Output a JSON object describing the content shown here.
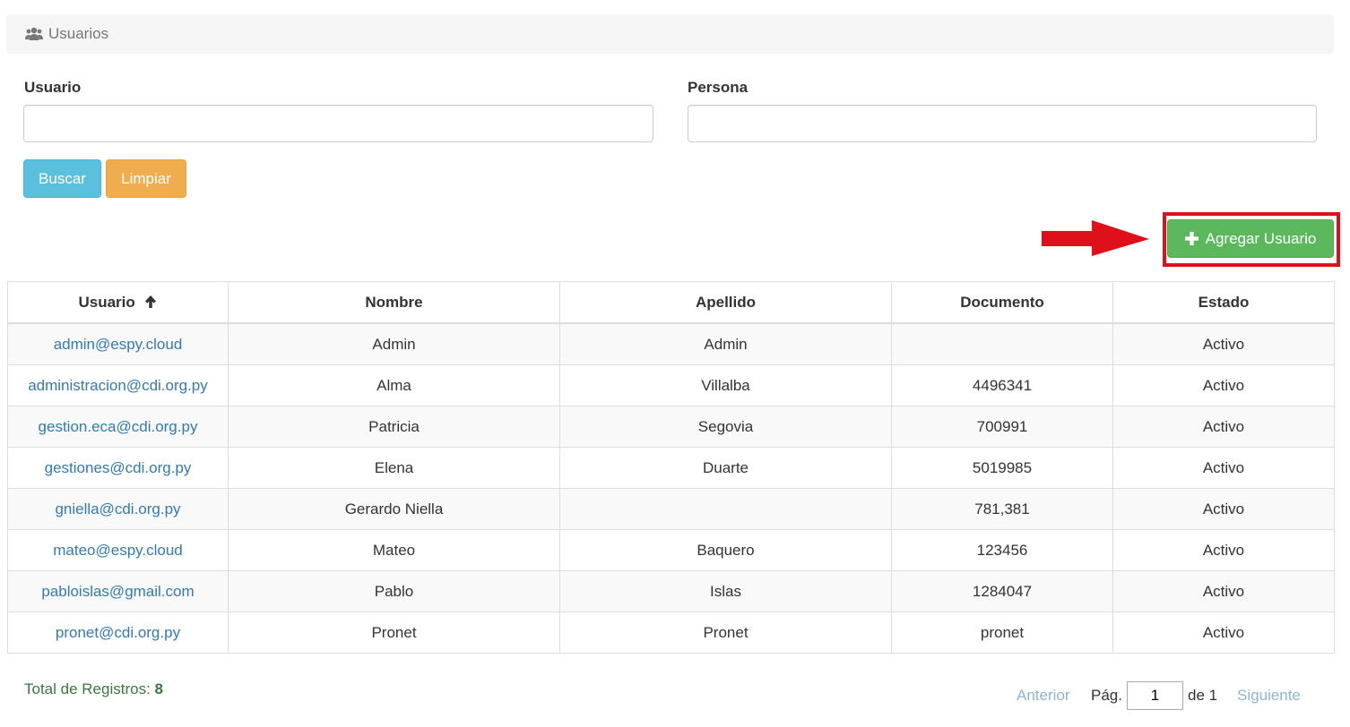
{
  "header": {
    "title": "Usuarios",
    "icon": "users-icon"
  },
  "filters": {
    "usuario_label": "Usuario",
    "usuario_value": "",
    "persona_label": "Persona",
    "persona_value": ""
  },
  "actions": {
    "buscar_label": "Buscar",
    "limpiar_label": "Limpiar",
    "agregar_label": "Agregar Usuario"
  },
  "table": {
    "columns": [
      "Usuario",
      "Nombre",
      "Apellido",
      "Documento",
      "Estado"
    ],
    "sort_column": "Usuario",
    "sort_direction": "ascending",
    "rows": [
      [
        "admin@espy.cloud",
        "Admin",
        "Admin",
        "",
        "Activo"
      ],
      [
        "administracion@cdi.org.py",
        "Alma",
        "Villalba",
        "4496341",
        "Activo"
      ],
      [
        "gestion.eca@cdi.org.py",
        "Patricia",
        "Segovia",
        "700991",
        "Activo"
      ],
      [
        "gestiones@cdi.org.py",
        "Elena",
        "Duarte",
        "5019985",
        "Activo"
      ],
      [
        "gniella@cdi.org.py",
        "Gerardo Niella",
        "",
        "781,381",
        "Activo"
      ],
      [
        "mateo@espy.cloud",
        "Mateo",
        "Baquero",
        "123456",
        "Activo"
      ],
      [
        "pabloislas@gmail.com",
        "Pablo",
        "Islas",
        "1284047",
        "Activo"
      ],
      [
        "pronet@cdi.org.py",
        "Pronet",
        "Pronet",
        "pronet",
        "Activo"
      ]
    ]
  },
  "footer": {
    "total_label": "Total de Registros:",
    "total_value": "8",
    "prev_label": "Anterior",
    "page_label": "Pág.",
    "page_value": "1",
    "of_label": "de 1",
    "next_label": "Siguiente"
  },
  "colors": {
    "info": "#5bc0de",
    "warning": "#f0ad4e",
    "success": "#5cb85c",
    "link": "#337ab7",
    "highlight": "#e0101a"
  }
}
